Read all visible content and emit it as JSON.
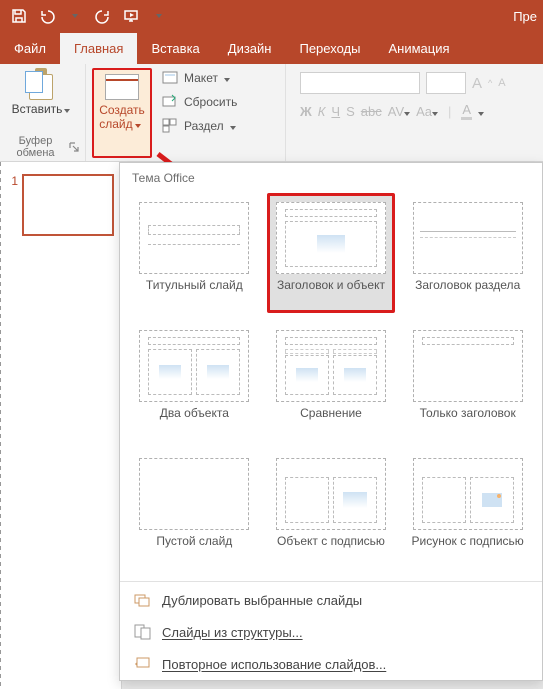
{
  "colors": {
    "primary": "#b7472a",
    "highlight": "#d91c1c"
  },
  "titlebar": {
    "app_title_fragment": "Пре"
  },
  "tabs": {
    "file": "Файл",
    "home": "Главная",
    "insert": "Вставка",
    "design": "Дизайн",
    "transitions": "Переходы",
    "animations": "Анимация"
  },
  "ribbon": {
    "clipboard": {
      "paste": "Вставить",
      "group_label": "Буфер обмена"
    },
    "slides": {
      "new_slide_line1": "Создать",
      "new_slide_line2": "слайд",
      "layout": "Макет",
      "reset": "Сбросить",
      "section": "Раздел"
    },
    "font": {
      "bold": "Ж",
      "italic": "К",
      "underline": "Ч",
      "shadow": "S",
      "strike": "abc",
      "spacing": "AV",
      "case": "Aa",
      "color": "A",
      "grow": "A",
      "shrink": "A"
    }
  },
  "thumbnails": {
    "slide1_num": "1"
  },
  "gallery": {
    "theme_label": "Тема Office",
    "layouts": [
      {
        "id": "title-slide",
        "label": "Титульный слайд"
      },
      {
        "id": "title-content",
        "label": "Заголовок и объект"
      },
      {
        "id": "section-header",
        "label": "Заголовок раздела"
      },
      {
        "id": "two-content",
        "label": "Два объекта"
      },
      {
        "id": "comparison",
        "label": "Сравнение"
      },
      {
        "id": "title-only",
        "label": "Только заголовок"
      },
      {
        "id": "blank",
        "label": "Пустой слайд"
      },
      {
        "id": "content-caption",
        "label": "Объект с подписью"
      },
      {
        "id": "picture-caption",
        "label": "Рисунок с подписью"
      }
    ],
    "menu": {
      "duplicate": "Дублировать выбранные слайды",
      "from_outline": "Слайды из структуры...",
      "reuse": "Повторное использование слайдов..."
    }
  }
}
